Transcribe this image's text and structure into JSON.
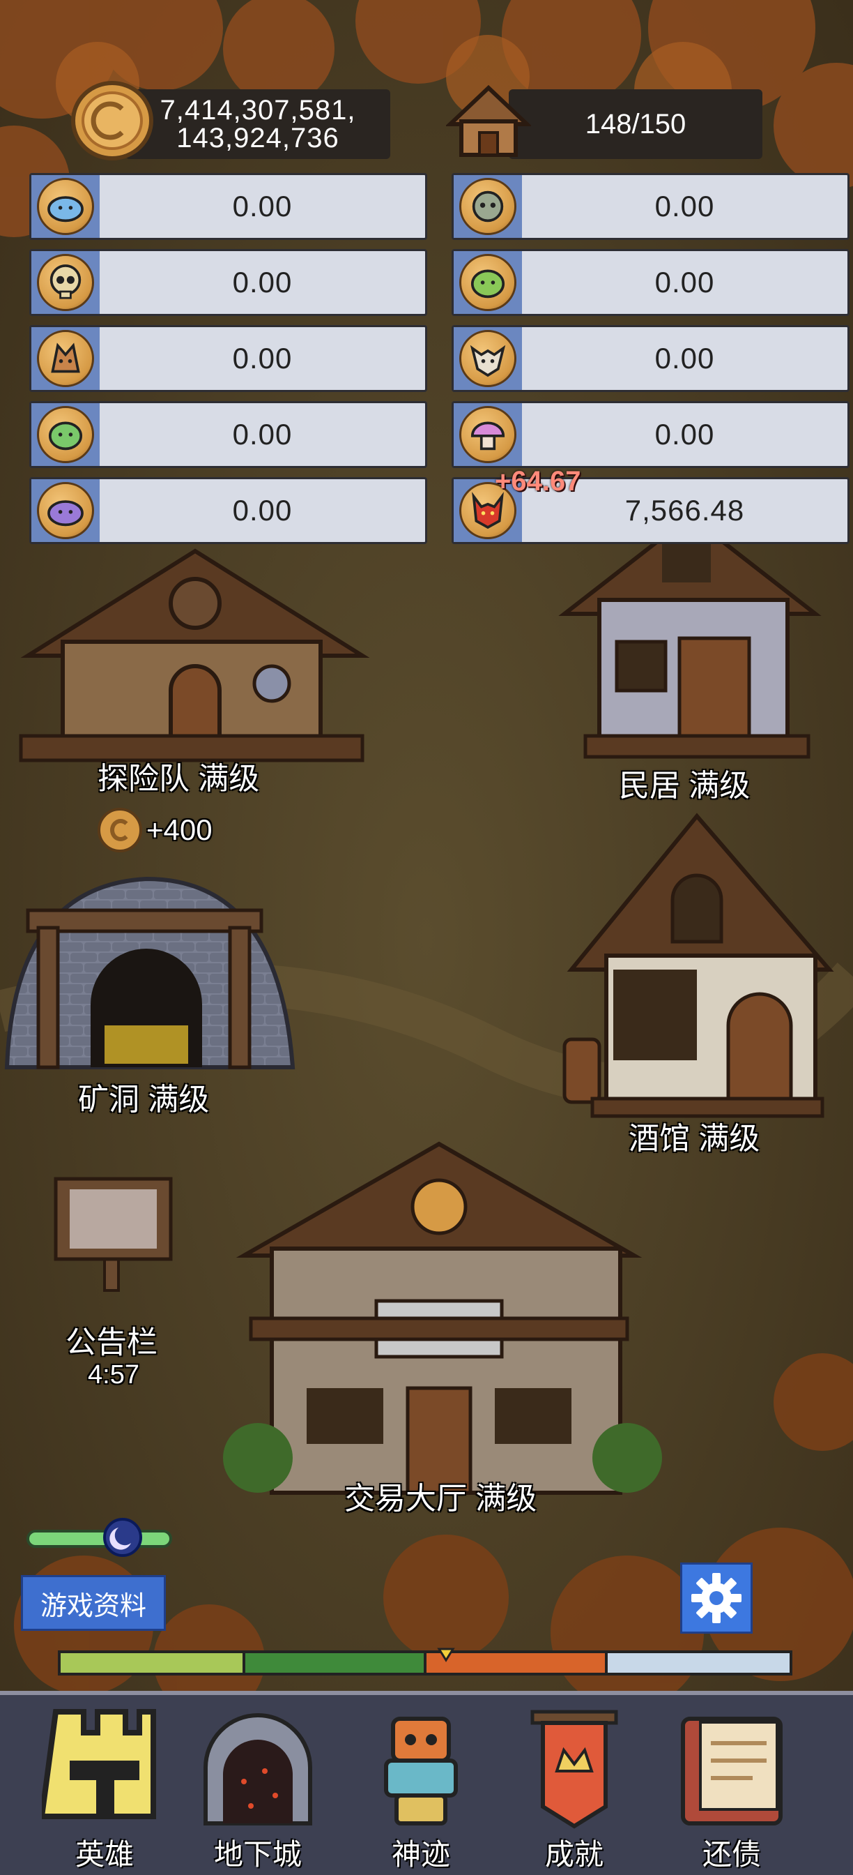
{
  "currency": {
    "gold_line1": "7,414,307,581,",
    "gold_line2": "143,924,736",
    "gold_icon": "coin-icon",
    "population": "148/150",
    "population_icon": "house-icon"
  },
  "resources_left": [
    {
      "icon": "slime-icon",
      "value": "0.00"
    },
    {
      "icon": "skull-icon",
      "value": "0.00"
    },
    {
      "icon": "tree-monster-icon",
      "value": "0.00"
    },
    {
      "icon": "goblin-icon",
      "value": "0.00"
    },
    {
      "icon": "purple-creature-icon",
      "value": "0.00"
    }
  ],
  "resources_right": [
    {
      "icon": "zombie-icon",
      "value": "0.00"
    },
    {
      "icon": "orc-icon",
      "value": "0.00"
    },
    {
      "icon": "wolf-icon",
      "value": "0.00"
    },
    {
      "icon": "mushroom-icon",
      "value": "0.00"
    },
    {
      "icon": "demon-icon",
      "value": "7,566.48"
    }
  ],
  "gain_popup": "+64.67",
  "buildings": {
    "expedition": "探险队 满级",
    "expedition_reward": "+400",
    "residence": "民居 满级",
    "mine": "矿洞 满级",
    "tavern": "酒馆 满级",
    "notice_board": "公告栏",
    "notice_timer": "4:57",
    "trade_hall": "交易大厅 满级"
  },
  "controls": {
    "game_info": "游戏资料",
    "settings_icon": "gear-icon",
    "day_night_progress": 0.5,
    "season_marker": 0.52
  },
  "nav": [
    {
      "label": "英雄",
      "icon": "castle-icon"
    },
    {
      "label": "地下城",
      "icon": "dungeon-icon"
    },
    {
      "label": "神迹",
      "icon": "totem-icon"
    },
    {
      "label": "成就",
      "icon": "banner-icon"
    },
    {
      "label": "还债",
      "icon": "book-icon"
    }
  ],
  "colors": {
    "accent_blue": "#3e6fcf",
    "panel": "#d8dce6",
    "gain_red": "#ff8a7a"
  }
}
